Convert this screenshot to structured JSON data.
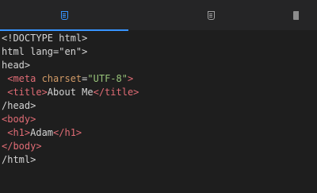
{
  "tabs": [
    {
      "icon": "html5-icon",
      "active": true
    },
    {
      "icon": "html5-icon",
      "active": false
    },
    {
      "icon": "file-icon",
      "active": false
    }
  ],
  "colors": {
    "background": "#1e1e1e",
    "tab_bar": "#252526",
    "accent": "#3794ff",
    "plain_text": "#d4d4d4",
    "tag": "#e06c75",
    "attribute": "#d19a66",
    "string": "#98c379"
  },
  "code": {
    "lines": [
      [
        {
          "text": "<!DOCTYPE html>",
          "kind": "plain"
        }
      ],
      [
        {
          "text": "html lang=\"en\">",
          "kind": "plain"
        }
      ],
      [
        {
          "text": "head>",
          "kind": "plain"
        }
      ],
      [
        {
          "text": " <meta ",
          "kind": "tag"
        },
        {
          "text": "charset",
          "kind": "attr"
        },
        {
          "text": "=",
          "kind": "plain"
        },
        {
          "text": "\"UTF-8\"",
          "kind": "string"
        },
        {
          "text": ">",
          "kind": "tag"
        }
      ],
      [
        {
          "text": " <title>",
          "kind": "tag"
        },
        {
          "text": "About Me",
          "kind": "plain"
        },
        {
          "text": "</title>",
          "kind": "tag"
        }
      ],
      [
        {
          "text": "/head>",
          "kind": "plain"
        }
      ],
      [
        {
          "text": "<body>",
          "kind": "tag"
        }
      ],
      [
        {
          "text": " <h1>",
          "kind": "tag"
        },
        {
          "text": "Adam",
          "kind": "plain"
        },
        {
          "text": "</h1>",
          "kind": "tag"
        }
      ],
      [
        {
          "text": "</body>",
          "kind": "tag"
        }
      ],
      [
        {
          "text": "/html>",
          "kind": "plain"
        }
      ]
    ]
  }
}
